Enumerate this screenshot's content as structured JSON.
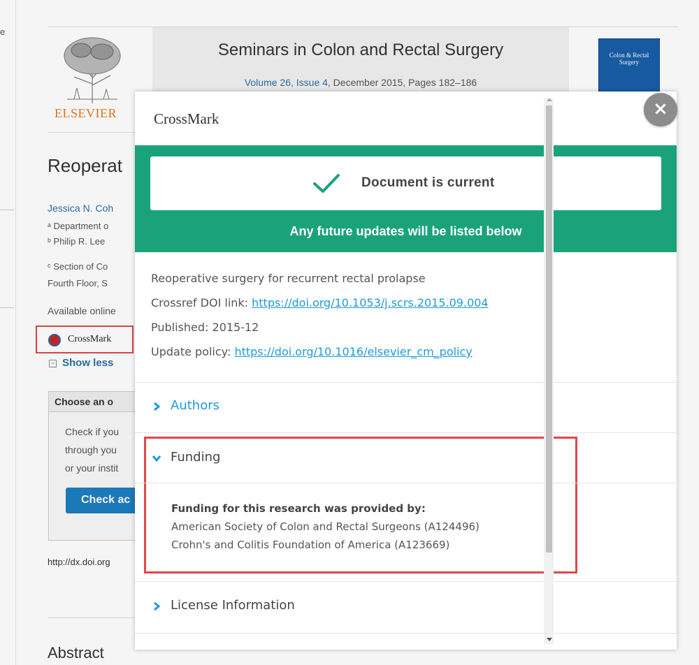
{
  "background": {
    "stray_char": "e",
    "journal": {
      "logo_text": "ELSEVIER",
      "title": "Seminars in Colon and Rectal Surgery",
      "volume_link": "Volume 26, Issue 4",
      "volume_rest": ", December 2015, Pages 182–186",
      "cover_text": "Colon & Rectal Surgery"
    },
    "article_title": "Reoperat",
    "author": "Jessica N. Coh",
    "affiliations": [
      "ᵃ Department o",
      "ᵇ Philip R. Lee",
      "ᶜ Section of Co",
      "Fourth Floor, S"
    ],
    "available_online": "Available online",
    "crossmark_label": "CrossMark",
    "show_less": "Show less",
    "access_box": {
      "heading": "Choose an o",
      "lines": [
        "Check if you",
        "through you",
        "or your instit"
      ],
      "button": "Check ac"
    },
    "doi": "http://dx.doi.org",
    "abstract": "Abstract"
  },
  "modal": {
    "title": "CrossMark",
    "status": "Document is current",
    "updates_note": "Any future updates will be listed below",
    "article_title": "Reoperative surgery for recurrent rectal prolapse",
    "doi_label": "Crossref DOI link: ",
    "doi_link": "https://doi.org/10.1053/j.scrs.2015.09.004",
    "published": "Published: 2015-12",
    "policy_label": "Update policy: ",
    "policy_link": "https://doi.org/10.1016/elsevier_cm_policy",
    "sections": {
      "authors": "Authors",
      "funding": "Funding",
      "license": "License Information"
    },
    "funding": {
      "heading": "Funding for this research was provided by:",
      "funders": [
        "American Society of Colon and Rectal Surgeons (A124496)",
        "Crohn's and Colitis Foundation of America (A123669)"
      ]
    },
    "close_glyph": "×"
  },
  "colors": {
    "status_green": "#1aa37a",
    "link_blue": "#1e9bd7",
    "highlight_red": "#e04848"
  }
}
